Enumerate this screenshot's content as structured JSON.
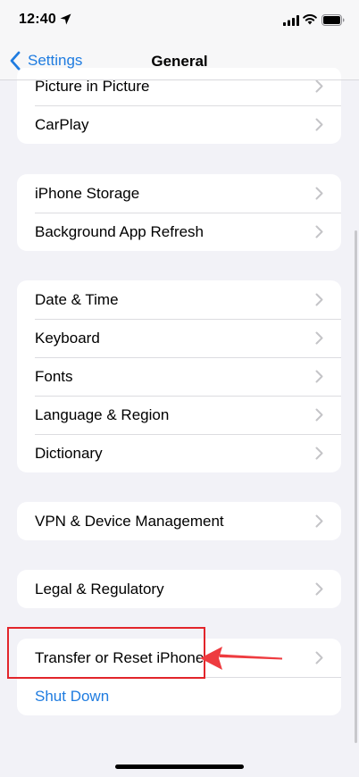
{
  "status_bar": {
    "time": "12:40",
    "icons": [
      "location-arrow-icon",
      "cellular-signal-icon",
      "wifi-icon",
      "battery-icon"
    ]
  },
  "nav": {
    "back_label": "Settings",
    "title": "General"
  },
  "groups": [
    {
      "items": [
        "Picture in Picture",
        "CarPlay"
      ]
    },
    {
      "items": [
        "iPhone Storage",
        "Background App Refresh"
      ]
    },
    {
      "items": [
        "Date & Time",
        "Keyboard",
        "Fonts",
        "Language & Region",
        "Dictionary"
      ]
    },
    {
      "items": [
        "VPN & Device Management"
      ]
    },
    {
      "items": [
        "Legal & Regulatory"
      ]
    },
    {
      "items": [
        "Transfer or Reset iPhone",
        "Shut Down"
      ]
    }
  ],
  "colors": {
    "background": "#f2f2f7",
    "accent": "#1f7ce0",
    "annotation": "#e2252b"
  }
}
